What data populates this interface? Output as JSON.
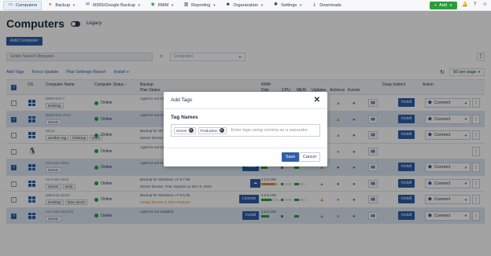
{
  "nav": {
    "items": [
      {
        "label": "Computers",
        "icon": "monitor-icon",
        "active": true
      },
      {
        "label": "Backup",
        "icon": "backup-icon"
      },
      {
        "label": "M365/Google Backup",
        "icon": "mail-icon"
      },
      {
        "label": "RMM",
        "icon": "rmm-icon"
      },
      {
        "label": "Reporting",
        "icon": "chart-icon"
      },
      {
        "label": "Organization",
        "icon": "users-icon"
      },
      {
        "label": "Settings",
        "icon": "gear-icon"
      },
      {
        "label": "Downloads",
        "icon": "download-icon"
      }
    ],
    "add_label": "Add",
    "accent": "#2a9d3c"
  },
  "page": {
    "title": "Computers",
    "legacy_label": "Legacy",
    "add_computer_label": "Add Computer"
  },
  "search": {
    "placeholder": "Enter Search Request",
    "computers_select": "Computers"
  },
  "actions": {
    "add_tags": "Add Tags",
    "force_update": "Force Update",
    "plan_settings_report": "Plan Settings Report",
    "install": "Install",
    "per_page": "50 per page"
  },
  "table": {
    "headers": {
      "os": "OS",
      "name": "Computer Name",
      "status": "Computer Status ↑",
      "backup": "Backup",
      "plan_status": "Plan Status",
      "rmm": "RMM",
      "disk": "Disk",
      "cpu": "CPU",
      "mem": "MEM",
      "updates": "Updates",
      "antivirus": "Antivirus",
      "events": "Events",
      "deep_instinct": "Deep Instinct",
      "action": "Action"
    },
    "rows": [
      {
        "name": "BMM-Win-7",
        "tags": [
          "Desktop"
        ],
        "status": "Online",
        "backup": "Agent is not installed",
        "backup2": "",
        "rmm": "",
        "selected": false,
        "os": "windows"
      },
      {
        "name": "BMM-Win-2022",
        "tags": [
          "Server"
        ],
        "status": "Online",
        "backup": "Agent is not installed",
        "backup2": "",
        "rmm": "",
        "selected": true,
        "os": "windows"
      },
      {
        "name": "win11",
        "tags": [
          "another tag",
          "Desktop",
          "test2"
        ],
        "status": "Online",
        "backup": "Backup for Wi",
        "backup2": "Server license",
        "rmm": "",
        "selected": false,
        "os": "windows"
      },
      {
        "name": "",
        "tags": [],
        "status": "Online",
        "backup": "Agent is not installed",
        "backup2": "",
        "rmm": "2.0.0.108",
        "selected": false,
        "os": "linux"
      },
      {
        "name": "rmm-win-2019",
        "tags": [
          "Server"
        ],
        "status": "Online",
        "backup": "Agent is not installed",
        "backup2": "",
        "rmm": "2.0.0.108",
        "selected": true,
        "os": "windows"
      },
      {
        "name": "rmm-win-2016",
        "tags": [
          "Server",
          "test2"
        ],
        "status": "Online",
        "backup": "Backup for Windows, v7.8.7.58",
        "backup2": "Server license, Trial. Expires on Dec 9, 2023",
        "rmm": "2.0.0.108",
        "selected": false,
        "os": "windows"
      },
      {
        "name": "qaibonly-win10",
        "tags": [
          "Desktop",
          "beta win10"
        ],
        "status": "Online",
        "backup": "Backup for Windows, v7.8.5.40",
        "backup2": "Assign license to this computer",
        "rmm": "2.0.0.108",
        "selected": false,
        "os": "windows"
      },
      {
        "name": "rmm-win-2012R2",
        "tags": [
          "Server"
        ],
        "status": "Online",
        "backup": "Agent is not installed",
        "backup2": "",
        "rmm": "2.0.0.108",
        "selected": true,
        "os": "windows"
      }
    ],
    "install_label": "Install",
    "license_label": "License",
    "connect_label": "Connect"
  },
  "modal": {
    "title": "Add Tags",
    "field_label": "Tag Names",
    "chips": [
      "Server",
      "Production"
    ],
    "placeholder": "Enter tags using comma as a separator",
    "save": "Save",
    "cancel": "Cancel"
  }
}
